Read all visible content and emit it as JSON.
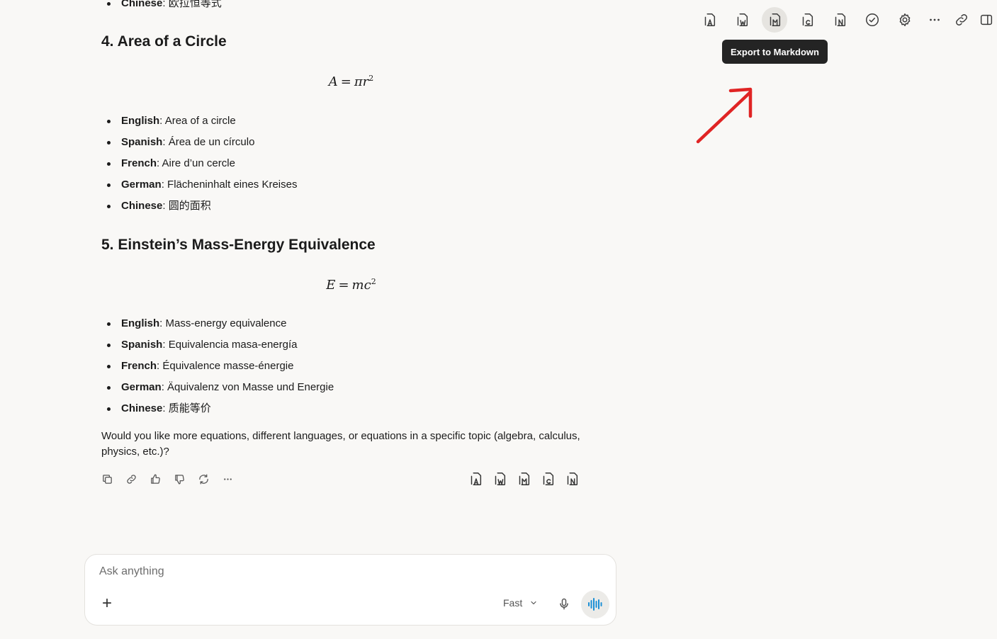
{
  "toolbar": {
    "buttons": [
      {
        "name": "export-pdf-button",
        "icon": "file-pdf-icon"
      },
      {
        "name": "export-word-button",
        "icon": "file-word-icon"
      },
      {
        "name": "export-markdown-button",
        "icon": "file-markdown-icon"
      },
      {
        "name": "export-gdocs-button",
        "icon": "file-g-icon"
      },
      {
        "name": "export-notion-button",
        "icon": "file-notion-icon"
      },
      {
        "name": "check-button",
        "icon": "check-circle-icon"
      },
      {
        "name": "settings-button",
        "icon": "gear-icon"
      },
      {
        "name": "more-button",
        "icon": "ellipsis-icon"
      },
      {
        "name": "link-button",
        "icon": "link-icon"
      },
      {
        "name": "sidebar-toggle-button",
        "icon": "sidebar-icon"
      }
    ],
    "tooltip": "Export to Markdown"
  },
  "content": {
    "prev_item": {
      "label": "Chinese",
      "value": "欧拉恒等式"
    },
    "sections": [
      {
        "heading": "4. Area of a Circle",
        "equation": {
          "lhs": "A",
          "rhs": "πr",
          "exp": "2"
        },
        "items": [
          {
            "label": "English",
            "value": "Area of a circle"
          },
          {
            "label": "Spanish",
            "value": "Área de un círculo"
          },
          {
            "label": "French",
            "value": "Aire d’un cercle"
          },
          {
            "label": "German",
            "value": "Flächeninhalt eines Kreises"
          },
          {
            "label": "Chinese",
            "value": "圆的面积"
          }
        ]
      },
      {
        "heading": "5. Einstein’s Mass-Energy Equivalence",
        "equation": {
          "lhs": "E",
          "rhs": "mc",
          "exp": "2"
        },
        "items": [
          {
            "label": "English",
            "value": "Mass-energy equivalence"
          },
          {
            "label": "Spanish",
            "value": "Equivalencia masa-energía"
          },
          {
            "label": "French",
            "value": "Équivalence masse-énergie"
          },
          {
            "label": "German",
            "value": "Äquivalenz von Masse und Energie"
          },
          {
            "label": "Chinese",
            "value": "质能等价"
          }
        ]
      }
    ],
    "closing": "Would you like more equations, different languages, or equations in a specific topic (algebra, calculus, physics, etc.)?"
  },
  "composer": {
    "placeholder": "Ask anything",
    "model": "Fast"
  },
  "colors": {
    "accent": "#1a8fd6",
    "arrow": "#e02424",
    "tooltip_bg": "#242424"
  }
}
